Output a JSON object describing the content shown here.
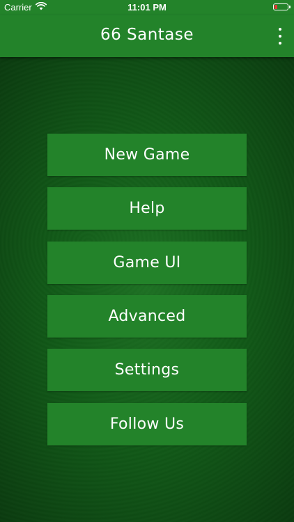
{
  "status_bar": {
    "carrier": "Carrier",
    "time": "11:01 PM",
    "battery_level_percent": 10
  },
  "app_bar": {
    "title": "66 Santase",
    "menu_icon": "more-vertical-icon"
  },
  "menu": {
    "items": [
      {
        "label": "New Game"
      },
      {
        "label": "Help"
      },
      {
        "label": "Game UI"
      },
      {
        "label": "Advanced"
      },
      {
        "label": "Settings"
      },
      {
        "label": "Follow Us"
      }
    ]
  },
  "colors": {
    "primary_green": "#23832a",
    "background_green": "#115c18",
    "battery_low": "#e53935",
    "text": "#ffffff"
  }
}
